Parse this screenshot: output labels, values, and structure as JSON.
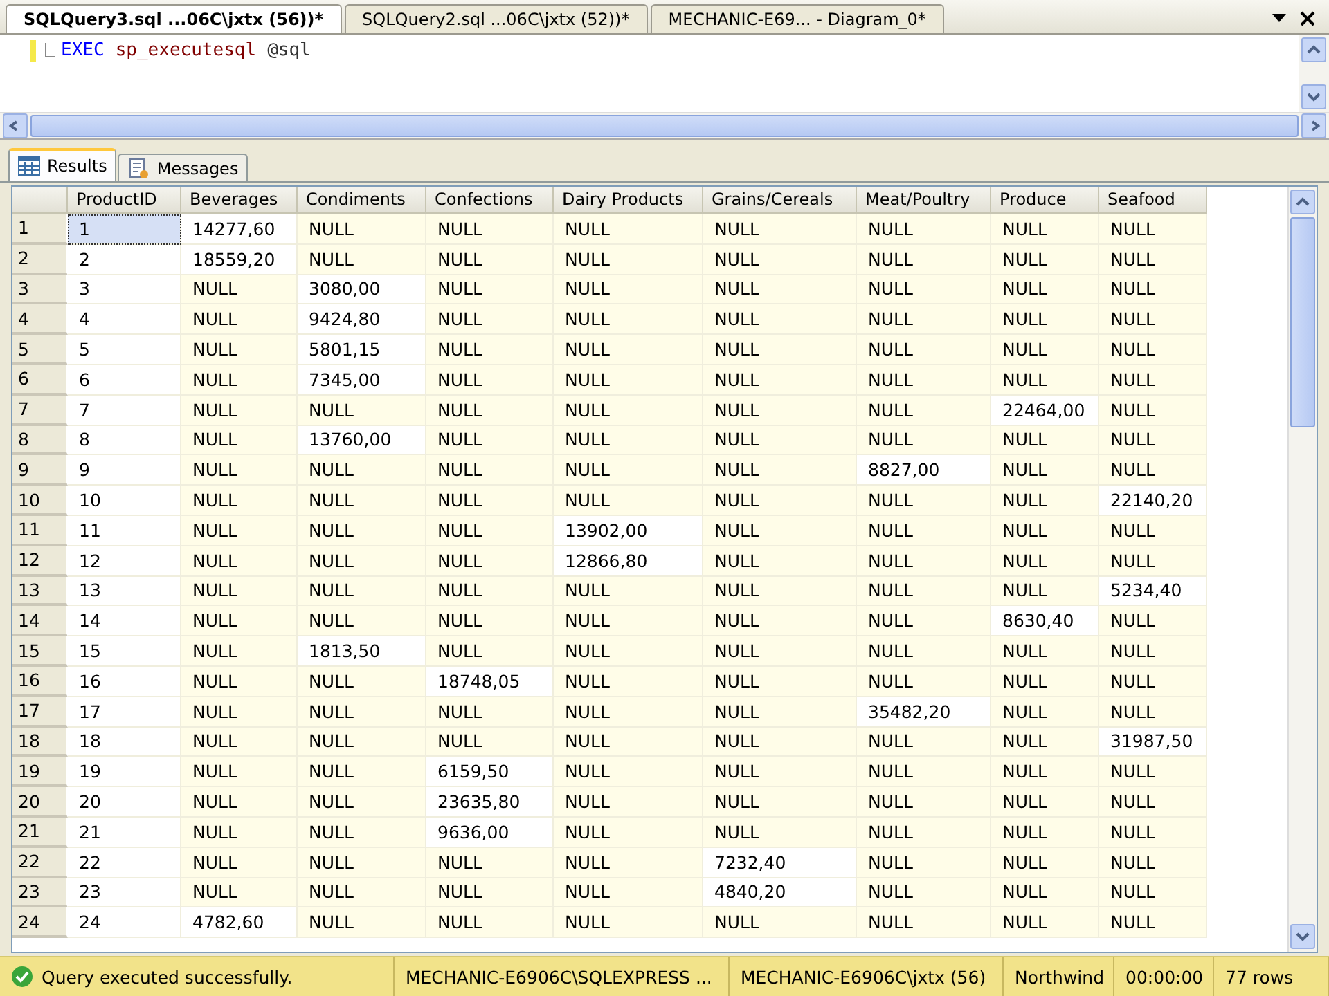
{
  "doc_tabs": [
    {
      "label": "SQLQuery3.sql ...06C\\jxtx (56))*",
      "selected": true
    },
    {
      "label": "SQLQuery2.sql ...06C\\jxtx (52))*",
      "selected": false
    },
    {
      "label": "MECHANIC-E69... - Diagram_0*",
      "selected": false
    }
  ],
  "editor": {
    "code": [
      {
        "text": "EXEC",
        "kind": "keyword"
      },
      {
        "text": "sp_executesql",
        "kind": "procedure"
      },
      {
        "text": "@sql",
        "kind": "variable"
      }
    ]
  },
  "result_tabs": [
    {
      "label": "Results",
      "selected": true,
      "kind": "grid"
    },
    {
      "label": "Messages",
      "selected": false,
      "kind": "messages"
    }
  ],
  "grid": {
    "columns": [
      "ProductID",
      "Beverages",
      "Condiments",
      "Confections",
      "Dairy Products",
      "Grains/Cereals",
      "Meat/Poultry",
      "Produce",
      "Seafood"
    ],
    "rows": [
      {
        "num": "1",
        "selected": true,
        "cells": [
          {
            "text": "1",
            "is_null": false
          },
          {
            "text": "14277,60",
            "is_null": false
          },
          {
            "text": "NULL",
            "is_null": true
          },
          {
            "text": "NULL",
            "is_null": true
          },
          {
            "text": "NULL",
            "is_null": true
          },
          {
            "text": "NULL",
            "is_null": true
          },
          {
            "text": "NULL",
            "is_null": true
          },
          {
            "text": "NULL",
            "is_null": true
          },
          {
            "text": "NULL",
            "is_null": true
          }
        ]
      },
      {
        "num": "2",
        "selected": false,
        "cells": [
          {
            "text": "2",
            "is_null": false
          },
          {
            "text": "18559,20",
            "is_null": false
          },
          {
            "text": "NULL",
            "is_null": true
          },
          {
            "text": "NULL",
            "is_null": true
          },
          {
            "text": "NULL",
            "is_null": true
          },
          {
            "text": "NULL",
            "is_null": true
          },
          {
            "text": "NULL",
            "is_null": true
          },
          {
            "text": "NULL",
            "is_null": true
          },
          {
            "text": "NULL",
            "is_null": true
          }
        ]
      },
      {
        "num": "3",
        "selected": false,
        "cells": [
          {
            "text": "3",
            "is_null": false
          },
          {
            "text": "NULL",
            "is_null": true
          },
          {
            "text": "3080,00",
            "is_null": false
          },
          {
            "text": "NULL",
            "is_null": true
          },
          {
            "text": "NULL",
            "is_null": true
          },
          {
            "text": "NULL",
            "is_null": true
          },
          {
            "text": "NULL",
            "is_null": true
          },
          {
            "text": "NULL",
            "is_null": true
          },
          {
            "text": "NULL",
            "is_null": true
          }
        ]
      },
      {
        "num": "4",
        "selected": false,
        "cells": [
          {
            "text": "4",
            "is_null": false
          },
          {
            "text": "NULL",
            "is_null": true
          },
          {
            "text": "9424,80",
            "is_null": false
          },
          {
            "text": "NULL",
            "is_null": true
          },
          {
            "text": "NULL",
            "is_null": true
          },
          {
            "text": "NULL",
            "is_null": true
          },
          {
            "text": "NULL",
            "is_null": true
          },
          {
            "text": "NULL",
            "is_null": true
          },
          {
            "text": "NULL",
            "is_null": true
          }
        ]
      },
      {
        "num": "5",
        "selected": false,
        "cells": [
          {
            "text": "5",
            "is_null": false
          },
          {
            "text": "NULL",
            "is_null": true
          },
          {
            "text": "5801,15",
            "is_null": false
          },
          {
            "text": "NULL",
            "is_null": true
          },
          {
            "text": "NULL",
            "is_null": true
          },
          {
            "text": "NULL",
            "is_null": true
          },
          {
            "text": "NULL",
            "is_null": true
          },
          {
            "text": "NULL",
            "is_null": true
          },
          {
            "text": "NULL",
            "is_null": true
          }
        ]
      },
      {
        "num": "6",
        "selected": false,
        "cells": [
          {
            "text": "6",
            "is_null": false
          },
          {
            "text": "NULL",
            "is_null": true
          },
          {
            "text": "7345,00",
            "is_null": false
          },
          {
            "text": "NULL",
            "is_null": true
          },
          {
            "text": "NULL",
            "is_null": true
          },
          {
            "text": "NULL",
            "is_null": true
          },
          {
            "text": "NULL",
            "is_null": true
          },
          {
            "text": "NULL",
            "is_null": true
          },
          {
            "text": "NULL",
            "is_null": true
          }
        ]
      },
      {
        "num": "7",
        "selected": false,
        "cells": [
          {
            "text": "7",
            "is_null": false
          },
          {
            "text": "NULL",
            "is_null": true
          },
          {
            "text": "NULL",
            "is_null": true
          },
          {
            "text": "NULL",
            "is_null": true
          },
          {
            "text": "NULL",
            "is_null": true
          },
          {
            "text": "NULL",
            "is_null": true
          },
          {
            "text": "NULL",
            "is_null": true
          },
          {
            "text": "22464,00",
            "is_null": false
          },
          {
            "text": "NULL",
            "is_null": true
          }
        ]
      },
      {
        "num": "8",
        "selected": false,
        "cells": [
          {
            "text": "8",
            "is_null": false
          },
          {
            "text": "NULL",
            "is_null": true
          },
          {
            "text": "13760,00",
            "is_null": false
          },
          {
            "text": "NULL",
            "is_null": true
          },
          {
            "text": "NULL",
            "is_null": true
          },
          {
            "text": "NULL",
            "is_null": true
          },
          {
            "text": "NULL",
            "is_null": true
          },
          {
            "text": "NULL",
            "is_null": true
          },
          {
            "text": "NULL",
            "is_null": true
          }
        ]
      },
      {
        "num": "9",
        "selected": false,
        "cells": [
          {
            "text": "9",
            "is_null": false
          },
          {
            "text": "NULL",
            "is_null": true
          },
          {
            "text": "NULL",
            "is_null": true
          },
          {
            "text": "NULL",
            "is_null": true
          },
          {
            "text": "NULL",
            "is_null": true
          },
          {
            "text": "NULL",
            "is_null": true
          },
          {
            "text": "8827,00",
            "is_null": false
          },
          {
            "text": "NULL",
            "is_null": true
          },
          {
            "text": "NULL",
            "is_null": true
          }
        ]
      },
      {
        "num": "10",
        "selected": false,
        "cells": [
          {
            "text": "10",
            "is_null": false
          },
          {
            "text": "NULL",
            "is_null": true
          },
          {
            "text": "NULL",
            "is_null": true
          },
          {
            "text": "NULL",
            "is_null": true
          },
          {
            "text": "NULL",
            "is_null": true
          },
          {
            "text": "NULL",
            "is_null": true
          },
          {
            "text": "NULL",
            "is_null": true
          },
          {
            "text": "NULL",
            "is_null": true
          },
          {
            "text": "22140,20",
            "is_null": false
          }
        ]
      },
      {
        "num": "11",
        "selected": false,
        "cells": [
          {
            "text": "11",
            "is_null": false
          },
          {
            "text": "NULL",
            "is_null": true
          },
          {
            "text": "NULL",
            "is_null": true
          },
          {
            "text": "NULL",
            "is_null": true
          },
          {
            "text": "13902,00",
            "is_null": false
          },
          {
            "text": "NULL",
            "is_null": true
          },
          {
            "text": "NULL",
            "is_null": true
          },
          {
            "text": "NULL",
            "is_null": true
          },
          {
            "text": "NULL",
            "is_null": true
          }
        ]
      },
      {
        "num": "12",
        "selected": false,
        "cells": [
          {
            "text": "12",
            "is_null": false
          },
          {
            "text": "NULL",
            "is_null": true
          },
          {
            "text": "NULL",
            "is_null": true
          },
          {
            "text": "NULL",
            "is_null": true
          },
          {
            "text": "12866,80",
            "is_null": false
          },
          {
            "text": "NULL",
            "is_null": true
          },
          {
            "text": "NULL",
            "is_null": true
          },
          {
            "text": "NULL",
            "is_null": true
          },
          {
            "text": "NULL",
            "is_null": true
          }
        ]
      },
      {
        "num": "13",
        "selected": false,
        "cells": [
          {
            "text": "13",
            "is_null": false
          },
          {
            "text": "NULL",
            "is_null": true
          },
          {
            "text": "NULL",
            "is_null": true
          },
          {
            "text": "NULL",
            "is_null": true
          },
          {
            "text": "NULL",
            "is_null": true
          },
          {
            "text": "NULL",
            "is_null": true
          },
          {
            "text": "NULL",
            "is_null": true
          },
          {
            "text": "NULL",
            "is_null": true
          },
          {
            "text": "5234,40",
            "is_null": false
          }
        ]
      },
      {
        "num": "14",
        "selected": false,
        "cells": [
          {
            "text": "14",
            "is_null": false
          },
          {
            "text": "NULL",
            "is_null": true
          },
          {
            "text": "NULL",
            "is_null": true
          },
          {
            "text": "NULL",
            "is_null": true
          },
          {
            "text": "NULL",
            "is_null": true
          },
          {
            "text": "NULL",
            "is_null": true
          },
          {
            "text": "NULL",
            "is_null": true
          },
          {
            "text": "8630,40",
            "is_null": false
          },
          {
            "text": "NULL",
            "is_null": true
          }
        ]
      },
      {
        "num": "15",
        "selected": false,
        "cells": [
          {
            "text": "15",
            "is_null": false
          },
          {
            "text": "NULL",
            "is_null": true
          },
          {
            "text": "1813,50",
            "is_null": false
          },
          {
            "text": "NULL",
            "is_null": true
          },
          {
            "text": "NULL",
            "is_null": true
          },
          {
            "text": "NULL",
            "is_null": true
          },
          {
            "text": "NULL",
            "is_null": true
          },
          {
            "text": "NULL",
            "is_null": true
          },
          {
            "text": "NULL",
            "is_null": true
          }
        ]
      },
      {
        "num": "16",
        "selected": false,
        "cells": [
          {
            "text": "16",
            "is_null": false
          },
          {
            "text": "NULL",
            "is_null": true
          },
          {
            "text": "NULL",
            "is_null": true
          },
          {
            "text": "18748,05",
            "is_null": false
          },
          {
            "text": "NULL",
            "is_null": true
          },
          {
            "text": "NULL",
            "is_null": true
          },
          {
            "text": "NULL",
            "is_null": true
          },
          {
            "text": "NULL",
            "is_null": true
          },
          {
            "text": "NULL",
            "is_null": true
          }
        ]
      },
      {
        "num": "17",
        "selected": false,
        "cells": [
          {
            "text": "17",
            "is_null": false
          },
          {
            "text": "NULL",
            "is_null": true
          },
          {
            "text": "NULL",
            "is_null": true
          },
          {
            "text": "NULL",
            "is_null": true
          },
          {
            "text": "NULL",
            "is_null": true
          },
          {
            "text": "NULL",
            "is_null": true
          },
          {
            "text": "35482,20",
            "is_null": false
          },
          {
            "text": "NULL",
            "is_null": true
          },
          {
            "text": "NULL",
            "is_null": true
          }
        ]
      },
      {
        "num": "18",
        "selected": false,
        "cells": [
          {
            "text": "18",
            "is_null": false
          },
          {
            "text": "NULL",
            "is_null": true
          },
          {
            "text": "NULL",
            "is_null": true
          },
          {
            "text": "NULL",
            "is_null": true
          },
          {
            "text": "NULL",
            "is_null": true
          },
          {
            "text": "NULL",
            "is_null": true
          },
          {
            "text": "NULL",
            "is_null": true
          },
          {
            "text": "NULL",
            "is_null": true
          },
          {
            "text": "31987,50",
            "is_null": false
          }
        ]
      },
      {
        "num": "19",
        "selected": false,
        "cells": [
          {
            "text": "19",
            "is_null": false
          },
          {
            "text": "NULL",
            "is_null": true
          },
          {
            "text": "NULL",
            "is_null": true
          },
          {
            "text": "6159,50",
            "is_null": false
          },
          {
            "text": "NULL",
            "is_null": true
          },
          {
            "text": "NULL",
            "is_null": true
          },
          {
            "text": "NULL",
            "is_null": true
          },
          {
            "text": "NULL",
            "is_null": true
          },
          {
            "text": "NULL",
            "is_null": true
          }
        ]
      },
      {
        "num": "20",
        "selected": false,
        "cells": [
          {
            "text": "20",
            "is_null": false
          },
          {
            "text": "NULL",
            "is_null": true
          },
          {
            "text": "NULL",
            "is_null": true
          },
          {
            "text": "23635,80",
            "is_null": false
          },
          {
            "text": "NULL",
            "is_null": true
          },
          {
            "text": "NULL",
            "is_null": true
          },
          {
            "text": "NULL",
            "is_null": true
          },
          {
            "text": "NULL",
            "is_null": true
          },
          {
            "text": "NULL",
            "is_null": true
          }
        ]
      },
      {
        "num": "21",
        "selected": false,
        "cells": [
          {
            "text": "21",
            "is_null": false
          },
          {
            "text": "NULL",
            "is_null": true
          },
          {
            "text": "NULL",
            "is_null": true
          },
          {
            "text": "9636,00",
            "is_null": false
          },
          {
            "text": "NULL",
            "is_null": true
          },
          {
            "text": "NULL",
            "is_null": true
          },
          {
            "text": "NULL",
            "is_null": true
          },
          {
            "text": "NULL",
            "is_null": true
          },
          {
            "text": "NULL",
            "is_null": true
          }
        ]
      },
      {
        "num": "22",
        "selected": false,
        "cells": [
          {
            "text": "22",
            "is_null": false
          },
          {
            "text": "NULL",
            "is_null": true
          },
          {
            "text": "NULL",
            "is_null": true
          },
          {
            "text": "NULL",
            "is_null": true
          },
          {
            "text": "NULL",
            "is_null": true
          },
          {
            "text": "7232,40",
            "is_null": false
          },
          {
            "text": "NULL",
            "is_null": true
          },
          {
            "text": "NULL",
            "is_null": true
          },
          {
            "text": "NULL",
            "is_null": true
          }
        ]
      },
      {
        "num": "23",
        "selected": false,
        "cells": [
          {
            "text": "23",
            "is_null": false
          },
          {
            "text": "NULL",
            "is_null": true
          },
          {
            "text": "NULL",
            "is_null": true
          },
          {
            "text": "NULL",
            "is_null": true
          },
          {
            "text": "NULL",
            "is_null": true
          },
          {
            "text": "4840,20",
            "is_null": false
          },
          {
            "text": "NULL",
            "is_null": true
          },
          {
            "text": "NULL",
            "is_null": true
          },
          {
            "text": "NULL",
            "is_null": true
          }
        ]
      },
      {
        "num": "24",
        "selected": false,
        "cells": [
          {
            "text": "24",
            "is_null": false
          },
          {
            "text": "4782,60",
            "is_null": false
          },
          {
            "text": "NULL",
            "is_null": true
          },
          {
            "text": "NULL",
            "is_null": true
          },
          {
            "text": "NULL",
            "is_null": true
          },
          {
            "text": "NULL",
            "is_null": true
          },
          {
            "text": "NULL",
            "is_null": true
          },
          {
            "text": "NULL",
            "is_null": true
          },
          {
            "text": "NULL",
            "is_null": true
          }
        ]
      }
    ]
  },
  "status_bar": {
    "message": "Query executed successfully.",
    "server": "MECHANIC-E6906C\\SQLEXPRESS ...",
    "user": "MECHANIC-E6906C\\jxtx (56)",
    "database": "Northwind",
    "elapsed": "00:00:00",
    "row_count": "77 rows"
  }
}
